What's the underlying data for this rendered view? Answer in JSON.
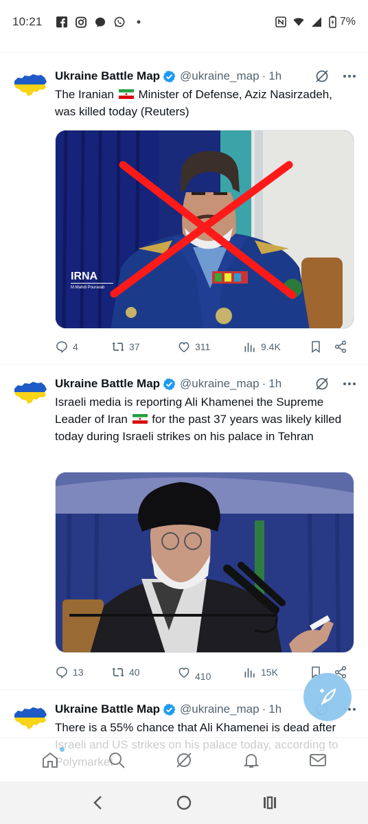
{
  "status_bar": {
    "time": "10:21",
    "battery": "7%",
    "left_icons": [
      "facebook-icon",
      "instagram-icon",
      "messenger-icon",
      "whatsapp-icon",
      "notification-dot"
    ],
    "right_icons": [
      "nfc-icon",
      "wifi-icon",
      "signal-icon",
      "battery-icon"
    ]
  },
  "tweets": [
    {
      "author": "Ukraine Battle Map",
      "handle": "@ukraine_map",
      "separator": "·",
      "time": "1h",
      "text_before_flag": "The Iranian ",
      "text_after_flag": " Minister of Defense, Aziz Nasirzadeh, was killed today (Reuters)",
      "media_watermark": "IRNA",
      "media_credit": "M.Mahdi Pourarab",
      "replies": "4",
      "reposts": "37",
      "likes": "311",
      "views": "9.4K"
    },
    {
      "author": "Ukraine Battle Map",
      "handle": "@ukraine_map",
      "separator": "·",
      "time": "1h",
      "text_before_flag": "Israeli media is reporting Ali Khamenei the Supreme Leader of Iran ",
      "text_after_flag": " for the past 37 years was likely killed today during Israeli strikes on his palace in Tehran",
      "replies": "13",
      "reposts": "40",
      "likes": "410",
      "views": "15K"
    },
    {
      "author": "Ukraine Battle Map",
      "handle": "@ukraine_map",
      "separator": "·",
      "time": "1h",
      "text": "There is a 55% chance that Ali Khamenei is dead after Israeli and US strikes on his palace today, according to Polymarket"
    }
  ],
  "colors": {
    "accent": "#1d9bf0",
    "verified": "#1d9bf0",
    "ukraine_blue": "#1e5bc6",
    "ukraine_yellow": "#f7d417",
    "red_x": "#ff1a1a",
    "fab": "#8fc7ef"
  },
  "tab_bar": [
    "home-icon",
    "search-icon",
    "grok-icon",
    "notifications-icon",
    "messages-icon"
  ],
  "system_nav": [
    "back-icon",
    "home-circle-icon",
    "recents-icon"
  ]
}
